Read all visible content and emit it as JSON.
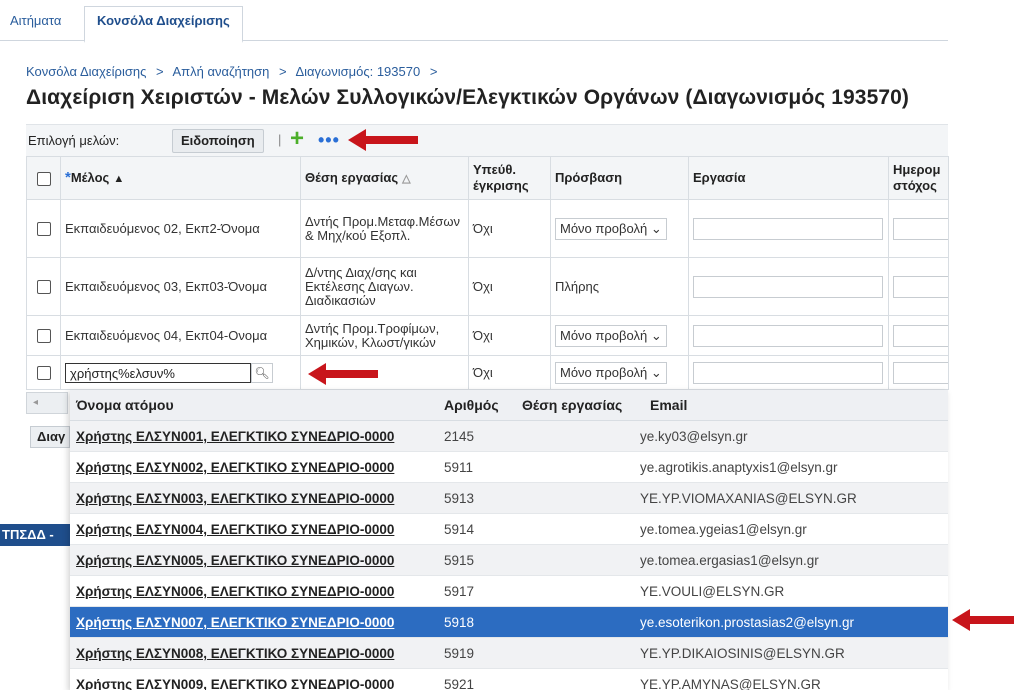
{
  "tabs": [
    {
      "label": "Αιτήματα"
    },
    {
      "label": "Κονσόλα Διαχείρισης"
    }
  ],
  "breadcrumb": {
    "items": [
      "Κονσόλα Διαχείρισης",
      "Απλή αναζήτηση",
      "Διαγωνισμός: 193570"
    ],
    "separator": ">"
  },
  "page_title": "Διαχείριση Χειριστών - Μελών Συλλογικών/Ελεγκτικών Οργάνων (Διαγωνισμός 193570)",
  "toolbar": {
    "label": "Επιλογή μελών:",
    "notify_label": "Ειδοποίηση",
    "separator": "|",
    "add_icon": "plus-icon",
    "more_icon": "ellipsis-icon"
  },
  "table": {
    "columns": {
      "member": "Μέλος",
      "job": "Θέση εργασίας",
      "approver": [
        "Υπεύθ.",
        "έγκρισης"
      ],
      "access": "Πρόσβαση",
      "task": "Εργασία",
      "date": [
        "Ημερομ",
        "στόχος"
      ]
    },
    "rows": [
      {
        "member": "Εκπαιδευόμενος 02, Εκπ2-Όνομα",
        "job": "Δντής Προμ.Μεταφ.Μέσων & Μηχ/κού Εξοπλ.",
        "approver": "Όχι",
        "access": "Μόνο προβολή"
      },
      {
        "member": "Εκπαιδευόμενος 03, Εκπ03-Όνομα",
        "job": "Δ/ντης Διαχ/σης και Εκτέλεσης Διαγων. Διαδικασιών",
        "approver": "Όχι",
        "access": "Πλήρης"
      },
      {
        "member": "Εκπαιδευόμενος 04, Εκπ04-Ονομα",
        "job": "Δντής Προμ.Τροφίμων, Χημικών, Κλωστ/γικών",
        "approver": "Όχι",
        "access": "Μόνο προβολή"
      }
    ],
    "new_row": {
      "search_value": "χρήστης%ελσυν%",
      "approver": "Όχι",
      "access": "Μόνο προβολή"
    }
  },
  "side": {
    "diag_stub": "Διαγ",
    "tsp_stub": "ΤΠΣΔΔ -"
  },
  "lov": {
    "columns": {
      "name": "Όνομα ατόμου",
      "number": "Αριθμός",
      "job": "Θέση εργασίας",
      "email": "Email"
    },
    "rows": [
      {
        "name": "Χρήστης ΕΛΣΥΝ001, ΕΛΕΓΚΤΙΚΟ ΣΥΝΕΔΡΙΟ-0000",
        "number": "2145",
        "email": "ye.ky03@elsyn.gr"
      },
      {
        "name": "Χρήστης ΕΛΣΥΝ002, ΕΛΕΓΚΤΙΚΟ ΣΥΝΕΔΡΙΟ-0000",
        "number": "5911",
        "email": "ye.agrotikis.anaptyxis1@elsyn.gr"
      },
      {
        "name": "Χρήστης ΕΛΣΥΝ003, ΕΛΕΓΚΤΙΚΟ ΣΥΝΕΔΡΙΟ-0000",
        "number": "5913",
        "email": "YE.YP.VIOMAXANIAS@ELSYN.GR"
      },
      {
        "name": "Χρήστης ΕΛΣΥΝ004, ΕΛΕΓΚΤΙΚΟ ΣΥΝΕΔΡΙΟ-0000",
        "number": "5914",
        "email": "ye.tomea.ygeias1@elsyn.gr"
      },
      {
        "name": "Χρήστης ΕΛΣΥΝ005, ΕΛΕΓΚΤΙΚΟ ΣΥΝΕΔΡΙΟ-0000",
        "number": "5915",
        "email": "ye.tomea.ergasias1@elsyn.gr"
      },
      {
        "name": "Χρήστης ΕΛΣΥΝ006, ΕΛΕΓΚΤΙΚΟ ΣΥΝΕΔΡΙΟ-0000",
        "number": "5917",
        "email": "YE.VOULI@ELSYN.GR"
      },
      {
        "name": "Χρήστης ΕΛΣΥΝ007, ΕΛΕΓΚΤΙΚΟ ΣΥΝΕΔΡΙΟ-0000",
        "number": "5918",
        "email": "ye.esoterikon.prostasias2@elsyn.gr",
        "selected": true
      },
      {
        "name": "Χρήστης ΕΛΣΥΝ008, ΕΛΕΓΚΤΙΚΟ ΣΥΝΕΔΡΙΟ-0000",
        "number": "5919",
        "email": "YE.YP.DIKAIOSINIS@ELSYN.GR"
      },
      {
        "name": "Χρήστης ΕΛΣΥΝ009, ΕΛΕΓΚΤΙΚΟ ΣΥΝΕΔΡΙΟ-0000",
        "number": "5921",
        "email": "YE.YP.AMYNAS@ELSYN.GR"
      }
    ]
  },
  "colors": {
    "accent": "#2c6cc1",
    "annotation_arrow": "#c8151b",
    "add_icon": "#4caf2a"
  }
}
